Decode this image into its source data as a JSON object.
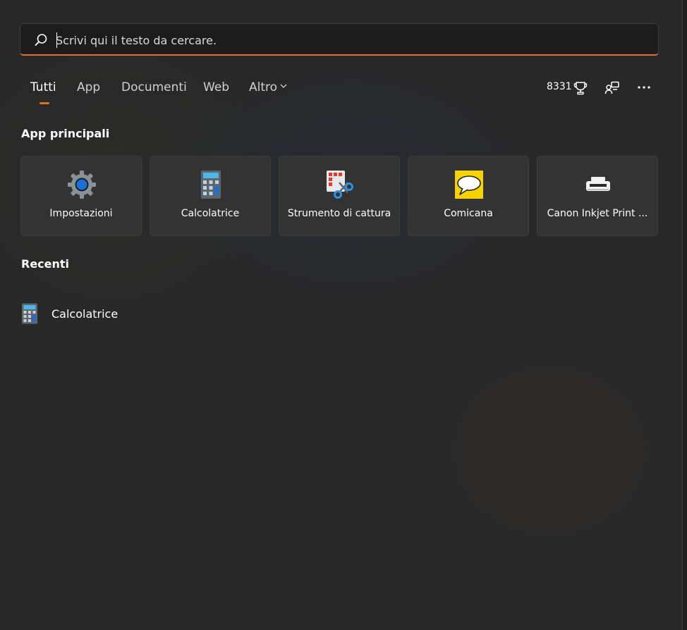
{
  "search": {
    "placeholder": "Scrivi qui il testo da cercare.",
    "value": "",
    "accent_color": "#e37026"
  },
  "tabs": [
    {
      "label": "Tutti",
      "active": true
    },
    {
      "label": "App",
      "active": false
    },
    {
      "label": "Documenti",
      "active": false
    },
    {
      "label": "Web",
      "active": false
    },
    {
      "label": "Altro",
      "active": false,
      "icon": "chevron-down-icon"
    }
  ],
  "toolbar": {
    "rewards_points": "8331",
    "rewards_icon": "trophy-icon",
    "share_icon": "share-devices-icon",
    "more_icon": "more-options-icon"
  },
  "top_apps": {
    "title": "App principali",
    "items": [
      {
        "label": "Impostazioni",
        "icon": "gear-icon"
      },
      {
        "label": "Calcolatrice",
        "icon": "calculator-icon"
      },
      {
        "label": "Strumento di cattura",
        "icon": "snipping-tool-icon"
      },
      {
        "label": "Comicana",
        "icon": "speech-bubble-icon"
      },
      {
        "label": "Canon Inkjet Print ...",
        "icon": "printer-icon"
      }
    ]
  },
  "recent": {
    "title": "Recenti",
    "items": [
      {
        "label": "Calcolatrice",
        "icon": "calculator-icon"
      }
    ]
  }
}
